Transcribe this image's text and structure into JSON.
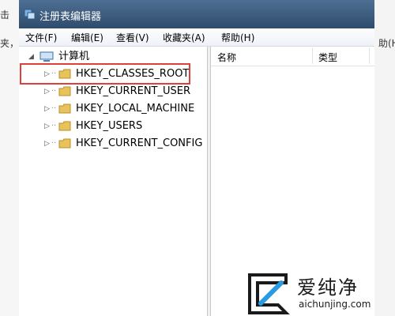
{
  "window": {
    "title": "注册表编辑器",
    "menu": [
      "文件(F)",
      "编辑(E)",
      "查看(V)",
      "收藏夹(A)",
      "帮助(H)"
    ]
  },
  "tree": {
    "root_label": "计算机",
    "keys": [
      "HKEY_CLASSES_ROOT",
      "HKEY_CURRENT_USER",
      "HKEY_LOCAL_MACHINE",
      "HKEY_USERS",
      "HKEY_CURRENT_CONFIG"
    ],
    "highlighted_key": "HKEY_CLASSES_ROOT"
  },
  "list": {
    "columns": [
      "名称",
      "类型"
    ]
  },
  "background": {
    "left_text_1": "击",
    "left_text_2": "夹，",
    "right_text": "助(H"
  },
  "watermark": {
    "brand": "爱纯净",
    "url": "aichunjing.com"
  },
  "colors": {
    "title_bar": "#3b5a7c",
    "highlight_border": "#e0403c",
    "folder": "#e8c25a"
  }
}
